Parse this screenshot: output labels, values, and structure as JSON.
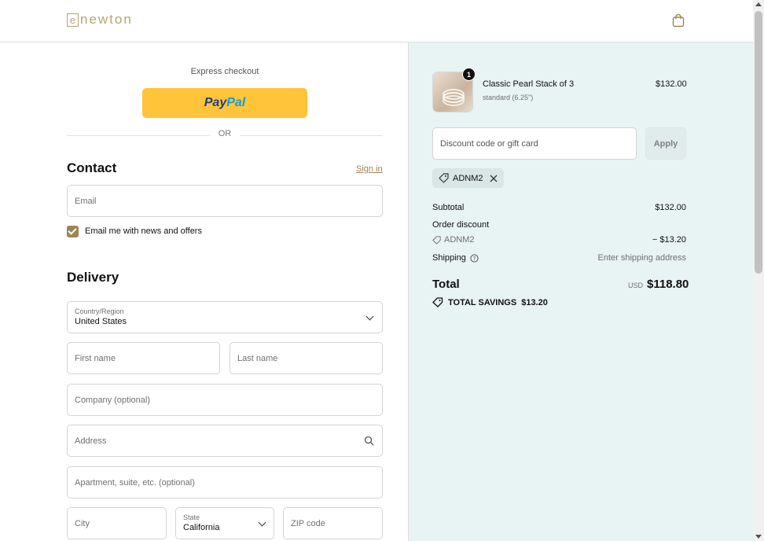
{
  "header": {
    "logo_box": "e",
    "logo_text": "newton"
  },
  "express": {
    "title": "Express checkout",
    "paypal_a": "Pay",
    "paypal_b": "Pal",
    "or": "OR"
  },
  "contact": {
    "heading": "Contact",
    "signin": "Sign in",
    "email_placeholder": "Email",
    "newsletter_label": "Email me with news and offers",
    "newsletter_checked": true
  },
  "delivery": {
    "heading": "Delivery",
    "country_label": "Country/Region",
    "country_value": "United States",
    "first_name": "First name",
    "last_name": "Last name",
    "company": "Company (optional)",
    "address": "Address",
    "apartment": "Apartment, suite, etc. (optional)",
    "city": "City",
    "state_label": "State",
    "state_value": "California",
    "zip": "ZIP code"
  },
  "summary": {
    "product": {
      "name": "Classic Pearl Stack of 3",
      "variant": "standard (6.25\")",
      "price": "$132.00",
      "quantity": "1"
    },
    "discount_placeholder": "Discount code or gift card",
    "apply_label": "Apply",
    "applied_code": "ADNM2",
    "subtotal_label": "Subtotal",
    "subtotal_value": "$132.00",
    "order_discount_label": "Order discount",
    "discount_code": "ADNM2",
    "discount_value": "− $13.20",
    "shipping_label": "Shipping",
    "shipping_value": "Enter shipping address",
    "total_label": "Total",
    "currency": "USD",
    "total_value": "$118.80",
    "savings_label": "TOTAL SAVINGS",
    "savings_value": "$13.20"
  },
  "colors": {
    "accent": "#9b8653",
    "summary_bg": "#e8f3f3",
    "paypal": "#ffc439"
  }
}
